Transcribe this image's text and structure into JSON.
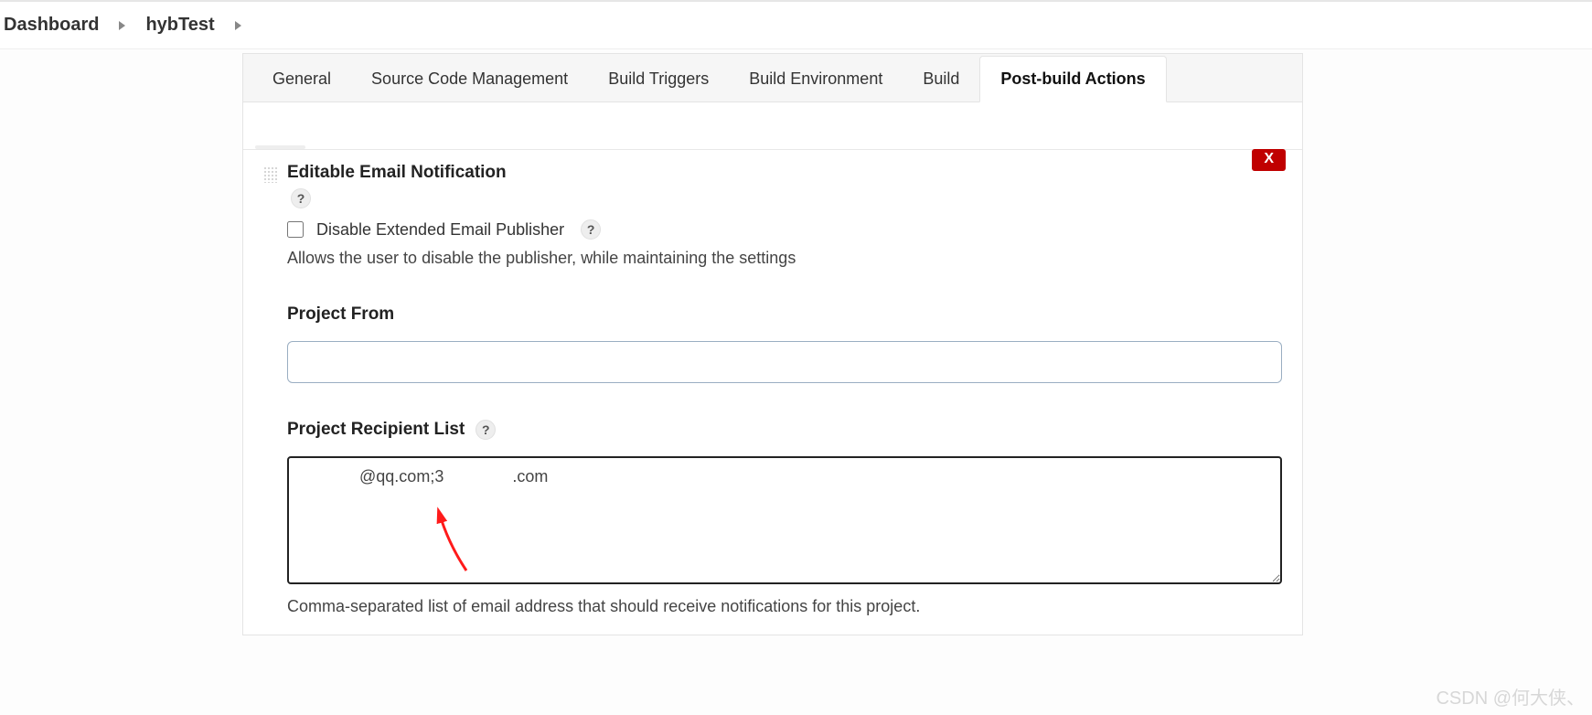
{
  "breadcrumb": {
    "items": [
      "Dashboard",
      "hybTest"
    ]
  },
  "tabs": {
    "general": "General",
    "scm": "Source Code Management",
    "triggers": "Build Triggers",
    "env": "Build Environment",
    "build": "Build",
    "post": "Post-build Actions",
    "active": "post"
  },
  "section": {
    "title": "Editable Email Notification",
    "delete_label": "X"
  },
  "disable_publisher": {
    "label": "Disable Extended Email Publisher",
    "checked": false,
    "help_text": "Allows the user to disable the publisher, while maintaining the settings"
  },
  "project_from": {
    "label": "Project From",
    "value": ""
  },
  "recipient_list": {
    "label": "Project Recipient List",
    "value": "             @qq.com;3               .com",
    "under": "Comma-separated list of email address that should receive notifications for this project."
  },
  "help_char": "?",
  "watermark": "CSDN @何大侠、"
}
